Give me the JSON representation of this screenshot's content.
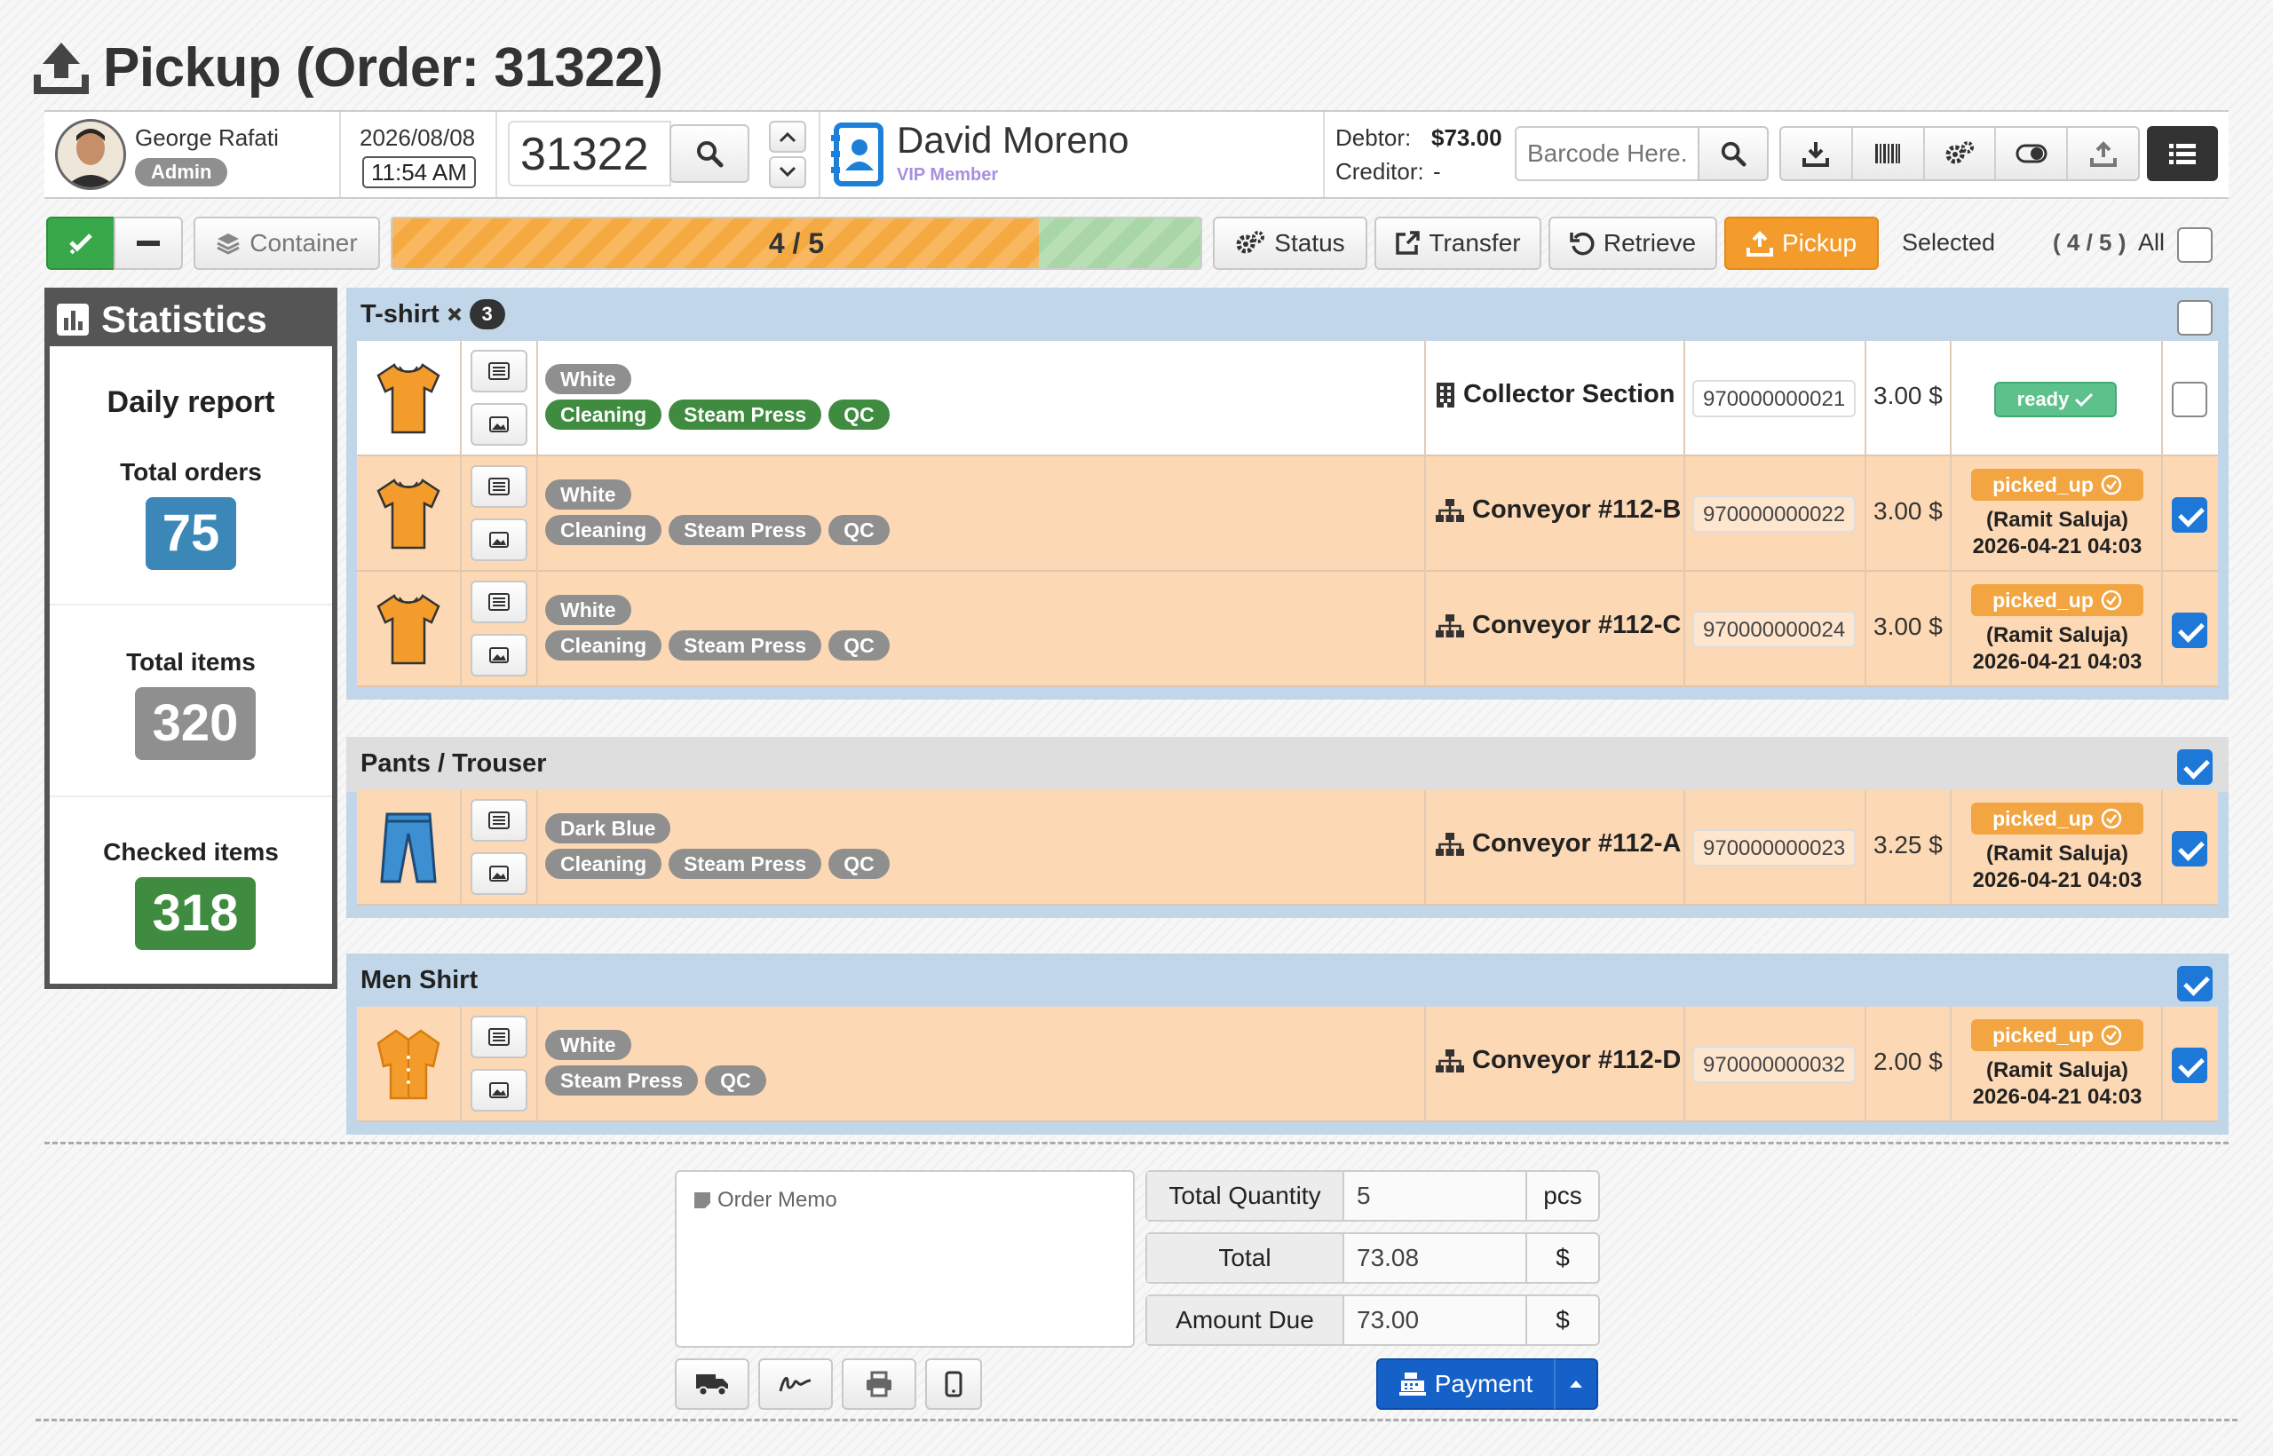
{
  "page": {
    "title": "Pickup (Order: 31322)"
  },
  "user": {
    "name": "George Rafati",
    "role": "Admin"
  },
  "datetime": {
    "date": "2026/08/08",
    "time": "11:54 AM"
  },
  "order_search": {
    "value": "31322"
  },
  "customer": {
    "name": "David Moreno",
    "tier": "VIP Member"
  },
  "account": {
    "debtor_label": "Debtor:",
    "debtor_value": "$73.00",
    "creditor_label": "Creditor:",
    "creditor_value": "-"
  },
  "barcode": {
    "placeholder": "Barcode Here."
  },
  "toolbar": {
    "container_label": "Container",
    "progress_text": "4 / 5",
    "progress_fraction": 0.8,
    "status_label": "Status",
    "transfer_label": "Transfer",
    "retrieve_label": "Retrieve",
    "pickup_label": "Pickup",
    "selected_label": "Selected",
    "selected_count": "( 4 / 5 )",
    "all_label": "All"
  },
  "statistics": {
    "title": "Statistics",
    "report_title": "Daily report",
    "total_orders_label": "Total orders",
    "total_orders": "75",
    "total_items_label": "Total items",
    "total_items": "320",
    "checked_items_label": "Checked items",
    "checked_items": "318"
  },
  "groups": [
    {
      "name": "T-shirt",
      "multiplier": "3",
      "checked": false,
      "items": [
        {
          "color": "White",
          "services": [
            "Cleaning",
            "Steam Press",
            "QC"
          ],
          "location": "Collector Section",
          "barcode": "970000000021",
          "price": "3.00 $",
          "status": "ready",
          "picked_by": "",
          "picked_at": "",
          "checked": false
        },
        {
          "color": "White",
          "services": [
            "Cleaning",
            "Steam Press",
            "QC"
          ],
          "location": "Conveyor #112-B",
          "barcode": "970000000022",
          "price": "3.00 $",
          "status": "picked_up",
          "picked_by": "(Ramit Saluja)",
          "picked_at": "2026-04-21 04:03",
          "checked": true
        },
        {
          "color": "White",
          "services": [
            "Cleaning",
            "Steam Press",
            "QC"
          ],
          "location": "Conveyor #112-C",
          "barcode": "970000000024",
          "price": "3.00 $",
          "status": "picked_up",
          "picked_by": "(Ramit Saluja)",
          "picked_at": "2026-04-21 04:03",
          "checked": true
        }
      ]
    },
    {
      "name": "Pants / Trouser",
      "multiplier": "",
      "checked": true,
      "items": [
        {
          "color": "Dark Blue",
          "services": [
            "Cleaning",
            "Steam Press",
            "QC"
          ],
          "location": "Conveyor #112-A",
          "barcode": "970000000023",
          "price": "3.25 $",
          "status": "picked_up",
          "picked_by": "(Ramit Saluja)",
          "picked_at": "2026-04-21 04:03",
          "checked": true
        }
      ]
    },
    {
      "name": "Men Shirt",
      "multiplier": "",
      "checked": true,
      "items": [
        {
          "color": "White",
          "services": [
            "Steam Press",
            "QC"
          ],
          "location": "Conveyor #112-D",
          "barcode": "970000000032",
          "price": "2.00 $",
          "status": "picked_up",
          "picked_by": "(Ramit Saluja)",
          "picked_at": "2026-04-21 04:03",
          "checked": true
        }
      ]
    }
  ],
  "memo": {
    "placeholder": "Order Memo"
  },
  "summary": {
    "qty_label": "Total Quantity",
    "qty_value": "5",
    "qty_unit": "pcs",
    "total_label": "Total",
    "total_value": "73.08",
    "total_unit": "$",
    "due_label": "Amount Due",
    "due_value": "73.00",
    "due_unit": "$"
  },
  "payment": {
    "label": "Payment"
  },
  "colors": {
    "accent_orange": "#f39c2b",
    "ready_green": "#5cc18a",
    "picked_orange": "#f2a541",
    "checkbox_blue": "#1e78d8",
    "row_highlight": "#fdd8b4"
  }
}
